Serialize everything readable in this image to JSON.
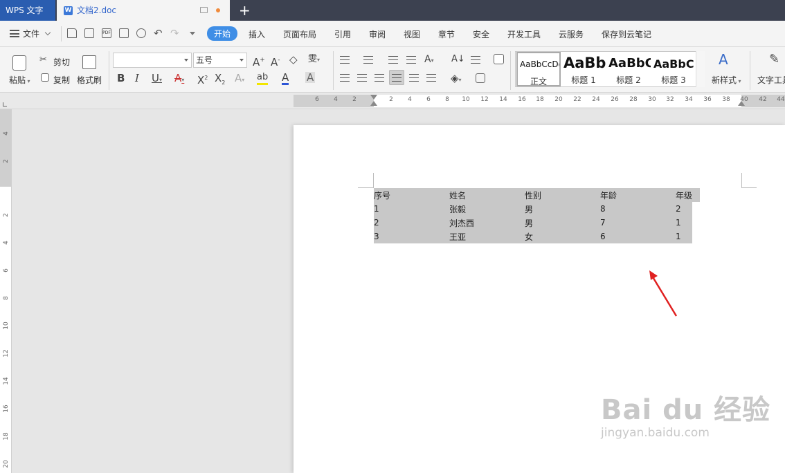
{
  "titlebar": {
    "app_tab": "WPS 文字",
    "doc_tab": "文档2.doc",
    "new_tab": "+"
  },
  "menubar": {
    "file": "文件",
    "items": [
      "开始",
      "插入",
      "页面布局",
      "引用",
      "审阅",
      "视图",
      "章节",
      "安全",
      "开发工具",
      "云服务",
      "保存到云笔记"
    ]
  },
  "ribbon": {
    "paste": "粘贴",
    "cut": "剪切",
    "copy": "复制",
    "format_painter": "格式刷",
    "font_name": "",
    "font_size": "五号",
    "styles": [
      {
        "sample": "AaBbCcDd",
        "name": "正文"
      },
      {
        "sample": "AaBb",
        "name": "标题 1"
      },
      {
        "sample": "AaBbC",
        "name": "标题 2"
      },
      {
        "sample": "AaBbC",
        "name": "标题 3"
      }
    ],
    "new_style": "新样式",
    "text_tools": "文字工具"
  },
  "hruler": {
    "labels": [
      "6",
      "4",
      "2",
      "2",
      "4",
      "6",
      "8",
      "10",
      "12",
      "14",
      "16",
      "18",
      "20",
      "22",
      "24",
      "26",
      "28",
      "30",
      "32",
      "34",
      "36",
      "38",
      "40",
      "42",
      "44"
    ]
  },
  "vruler": {
    "labels": [
      "4",
      "2",
      "2",
      "4",
      "6",
      "8",
      "10",
      "12",
      "14",
      "16",
      "18",
      "20"
    ]
  },
  "table": {
    "headers": [
      "序号",
      "姓名",
      "性别",
      "年龄",
      "年级"
    ],
    "rows": [
      [
        "1",
        "张毅",
        "男",
        "8",
        "2"
      ],
      [
        "2",
        "刘杰西",
        "男",
        "7",
        "1"
      ],
      [
        "3",
        "王亚",
        "女",
        "6",
        "1"
      ]
    ]
  },
  "watermark": {
    "main": "Bai du 经验",
    "sub": "jingyan.baidu.com"
  },
  "colors": {
    "app_tab": "#2a5db0",
    "active_menu": "#3f8ee6",
    "annotation_arrow": "#e02020",
    "table_highlight": "#c8c8c8"
  }
}
